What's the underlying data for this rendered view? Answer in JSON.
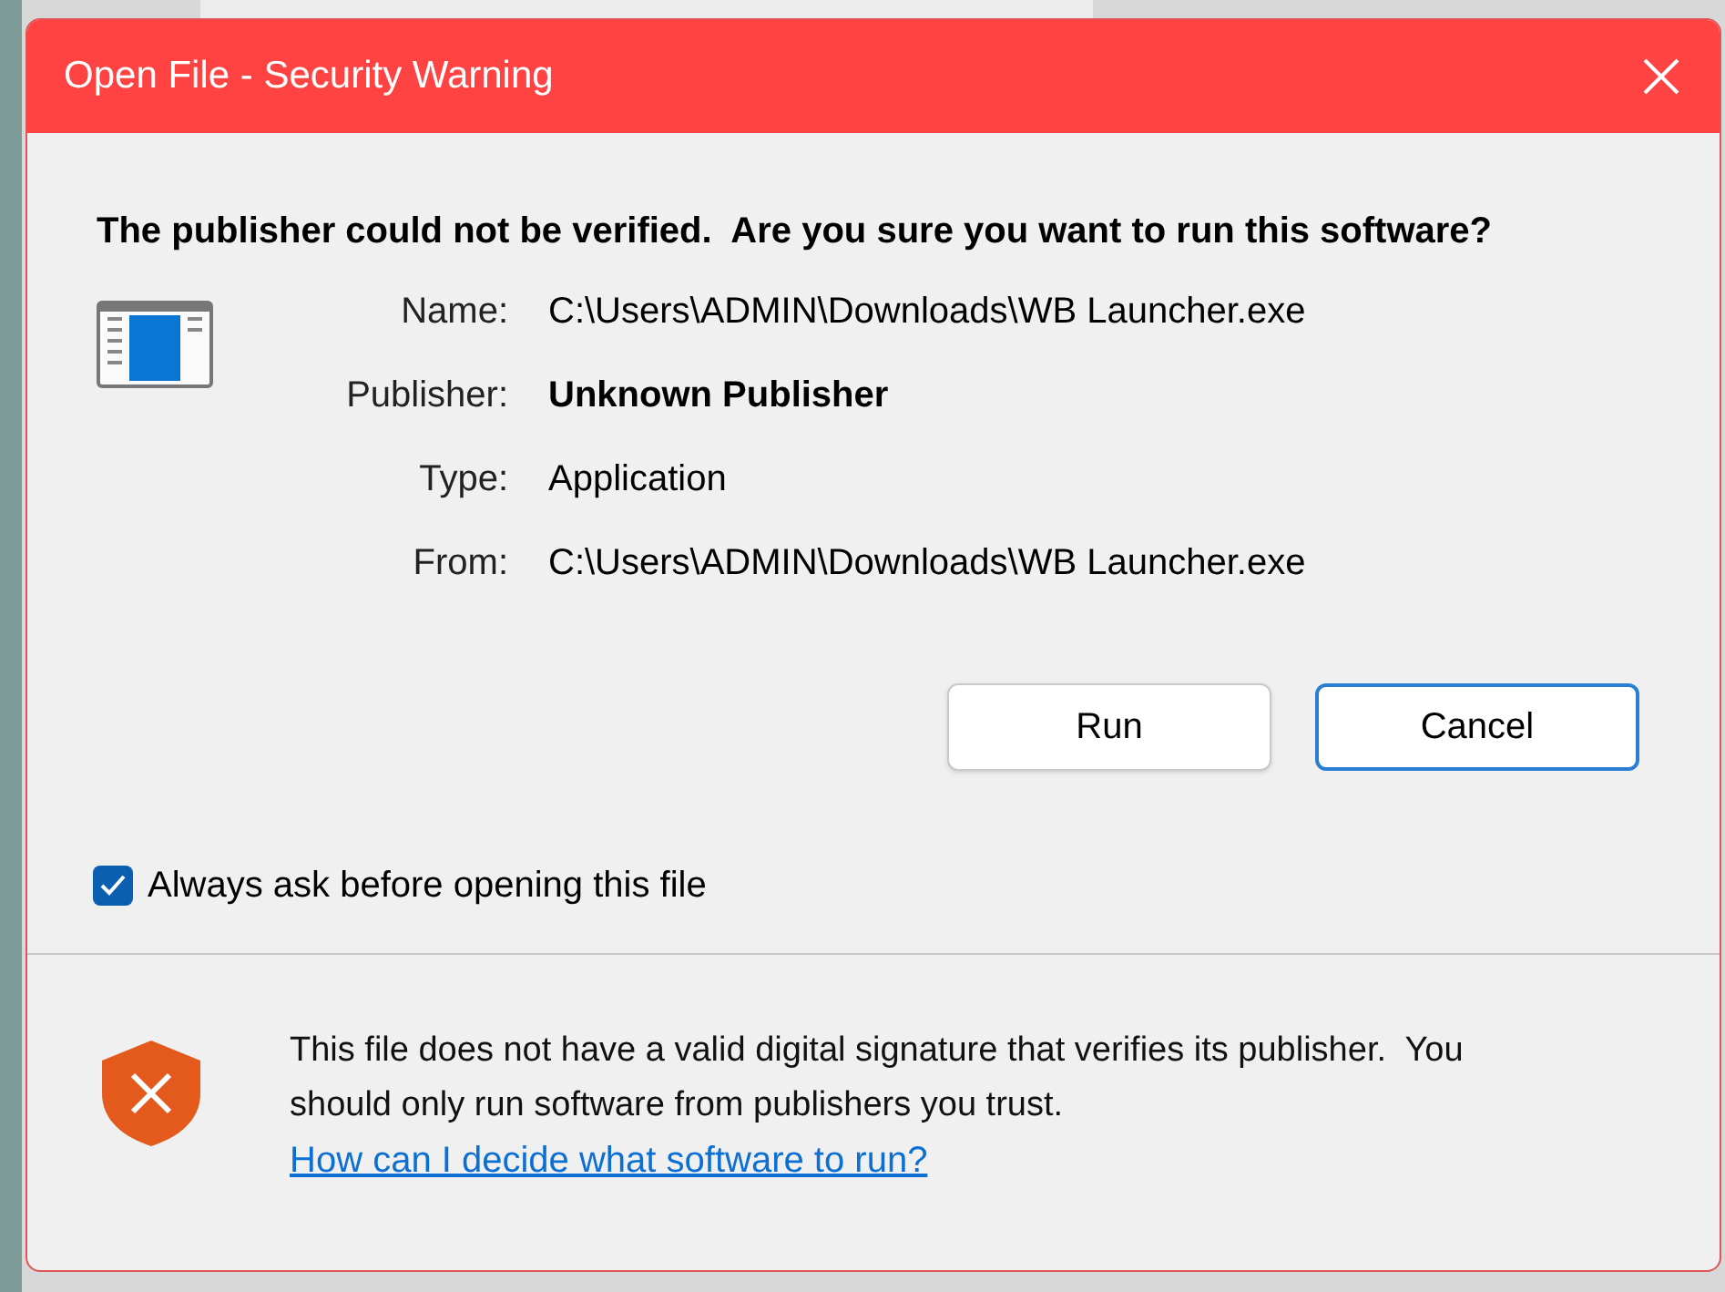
{
  "window": {
    "title": "Open File - Security Warning"
  },
  "heading": "The publisher could not be verified.  Are you sure you want to run this software?",
  "details": [
    {
      "label": "Name:",
      "value": "C:\\Users\\ADMIN\\Downloads\\WB Launcher.exe",
      "bold": false
    },
    {
      "label": "Publisher:",
      "value": "Unknown Publisher",
      "bold": true
    },
    {
      "label": "Type:",
      "value": "Application",
      "bold": false
    },
    {
      "label": "From:",
      "value": "C:\\Users\\ADMIN\\Downloads\\WB Launcher.exe",
      "bold": false
    }
  ],
  "buttons": [
    {
      "label": "Run",
      "focused": false
    },
    {
      "label": "Cancel",
      "focused": true
    }
  ],
  "always_ask": {
    "label": "Always ask before opening this file",
    "checked": true
  },
  "warning": {
    "text": "This file does not have a valid digital signature that verifies its publisher.  You should only run software from publishers you trust.",
    "link": "How can I decide what software to run?"
  }
}
